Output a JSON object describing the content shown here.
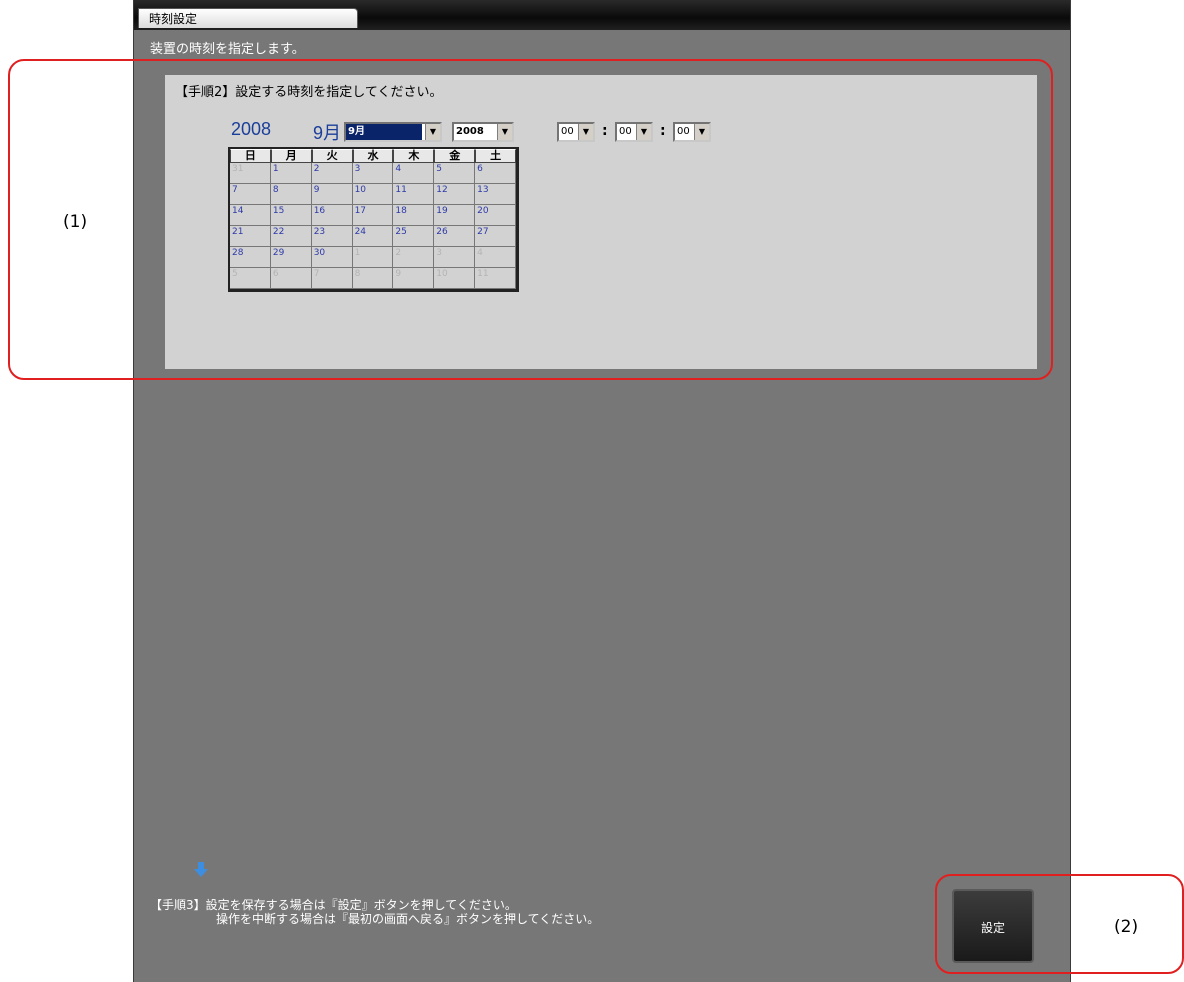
{
  "window": {
    "tab_title": "時刻設定",
    "subtitle": "装置の時刻を指定します。"
  },
  "step2": {
    "text": "【手順2】設定する時刻を指定してください。"
  },
  "calendar": {
    "year_display": "2008",
    "month_display": "9月",
    "month_select_value": "9月",
    "year_select_value": "2008",
    "weekdays": [
      "日",
      "月",
      "火",
      "水",
      "木",
      "金",
      "土"
    ],
    "weeks": [
      [
        {
          "d": "31",
          "other": true
        },
        {
          "d": "1"
        },
        {
          "d": "2"
        },
        {
          "d": "3"
        },
        {
          "d": "4"
        },
        {
          "d": "5"
        },
        {
          "d": "6"
        }
      ],
      [
        {
          "d": "7"
        },
        {
          "d": "8"
        },
        {
          "d": "9"
        },
        {
          "d": "10"
        },
        {
          "d": "11"
        },
        {
          "d": "12"
        },
        {
          "d": "13"
        }
      ],
      [
        {
          "d": "14"
        },
        {
          "d": "15"
        },
        {
          "d": "16"
        },
        {
          "d": "17"
        },
        {
          "d": "18"
        },
        {
          "d": "19"
        },
        {
          "d": "20"
        }
      ],
      [
        {
          "d": "21"
        },
        {
          "d": "22"
        },
        {
          "d": "23"
        },
        {
          "d": "24"
        },
        {
          "d": "25"
        },
        {
          "d": "26"
        },
        {
          "d": "27"
        }
      ],
      [
        {
          "d": "28"
        },
        {
          "d": "29"
        },
        {
          "d": "30"
        },
        {
          "d": "1",
          "other": true
        },
        {
          "d": "2",
          "other": true
        },
        {
          "d": "3",
          "other": true
        },
        {
          "d": "4",
          "other": true
        }
      ],
      [
        {
          "d": "5",
          "other": true
        },
        {
          "d": "6",
          "other": true
        },
        {
          "d": "7",
          "other": true
        },
        {
          "d": "8",
          "other": true
        },
        {
          "d": "9",
          "other": true
        },
        {
          "d": "10",
          "other": true
        },
        {
          "d": "11",
          "other": true
        }
      ]
    ]
  },
  "time": {
    "hour": "00",
    "minute": "00",
    "second": "00",
    "separator": ":"
  },
  "step3": {
    "line1": "【手順3】設定を保存する場合は『設定』ボタンを押してください。",
    "line2": "操作を中断する場合は『最初の画面へ戻る』ボタンを押してください。"
  },
  "buttons": {
    "set_label": "設定"
  },
  "annotations": {
    "label1": "(1)",
    "label2": "(2)",
    "color": "#e02020"
  },
  "colors": {
    "background": "#777777",
    "panel": "#d2d2d2",
    "calendar_text": "#1a3f9a",
    "selection": "#0a246a"
  },
  "icons": {
    "step3_arrow": "down-arrow-icon",
    "combo_arrow": "chevron-down-icon"
  }
}
